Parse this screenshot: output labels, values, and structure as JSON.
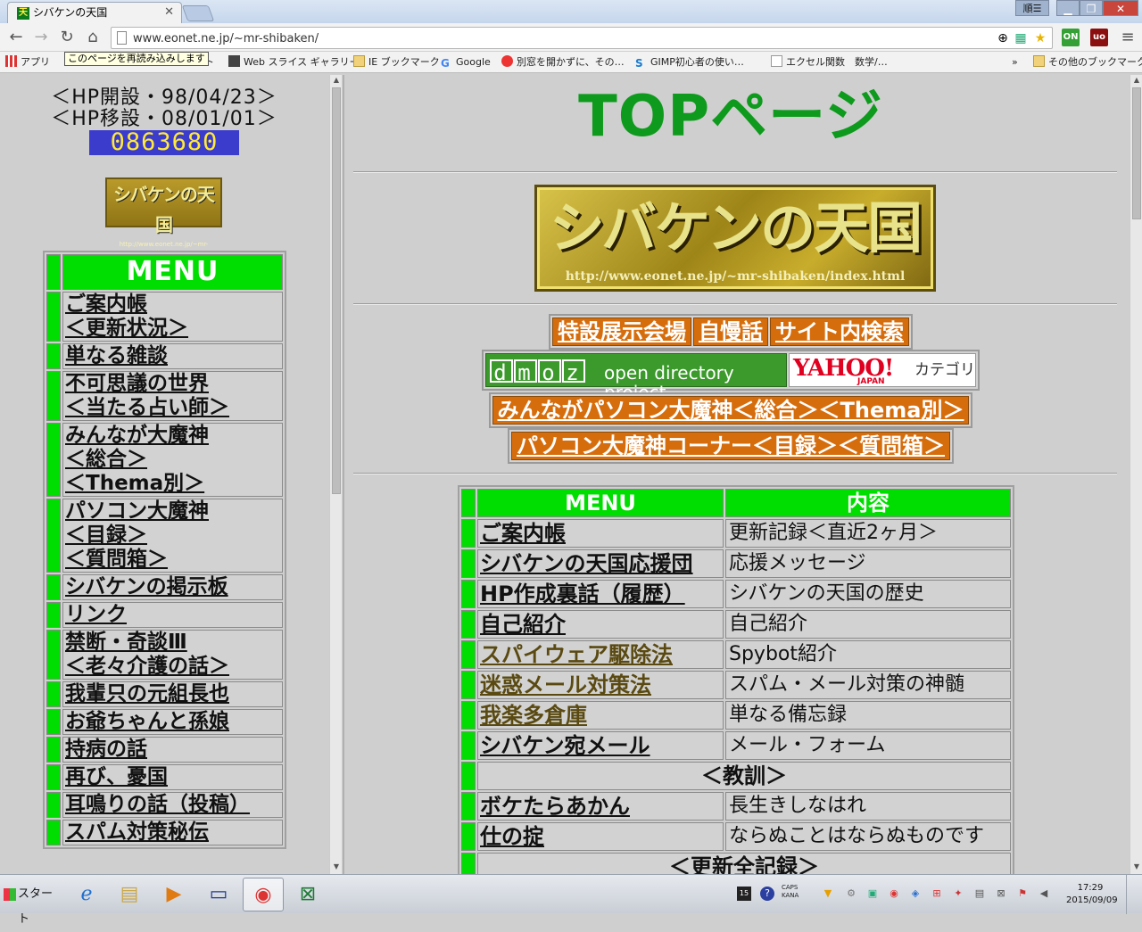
{
  "browser": {
    "tab_title": "シバケンの天国",
    "tab_favicon": "天",
    "window_user": "順",
    "url": "www.eonet.ne.jp/~mr-shibaken/",
    "tooltip": "このページを再読み込みします",
    "bookmarks": [
      {
        "label": "アプリ",
        "icon": "apps-grid-icon"
      },
      {
        "label": "イト",
        "icon": "page-icon"
      },
      {
        "label": "Web スライス ギャラリー",
        "icon": "web-slice-icon"
      },
      {
        "label": "IE ブックマーク",
        "icon": "folder-icon"
      },
      {
        "label": "Google",
        "icon": "google-icon"
      },
      {
        "label": "別窓を開かずに、その…",
        "icon": "red-ball-icon"
      },
      {
        "label": "GIMP初心者の使い…",
        "icon": "s-icon"
      },
      {
        "label": "エクセル関数　数学/…",
        "icon": "page-icon"
      }
    ],
    "bookmarks_overflow": "»",
    "other_bookmarks": "その他のブックマーク"
  },
  "sidebar": {
    "hp_open": "＜HP開設・98/04/23＞",
    "hp_move": "＜HP移設・08/01/01＞",
    "counter": "0863680",
    "small_logo_text": "シバケンの天国",
    "small_logo_url": "http://www.eonet.ne.jp/~mr-shibaken/",
    "menu_title": "MENU",
    "menu_items": [
      {
        "lines": [
          "ご案内帳",
          "＜更新状況＞"
        ]
      },
      {
        "lines": [
          "単なる雑談"
        ]
      },
      {
        "lines": [
          "不可思議の世界",
          "＜当たる占い師＞"
        ]
      },
      {
        "lines": [
          "みんなが大魔神",
          "＜総合＞",
          "＜Thema別＞"
        ]
      },
      {
        "lines": [
          "パソコン大魔神",
          "＜目録＞",
          "＜質問箱＞"
        ]
      },
      {
        "lines": [
          "シバケンの掲示板"
        ]
      },
      {
        "lines": [
          "リンク"
        ]
      },
      {
        "lines": [
          "禁断・奇談Ⅲ",
          "＜老々介護の話＞"
        ]
      },
      {
        "lines": [
          "我輩只の元組長也"
        ]
      },
      {
        "lines": [
          "お爺ちゃんと孫娘"
        ]
      },
      {
        "lines": [
          "持病の話"
        ]
      },
      {
        "lines": [
          "再び、憂国"
        ]
      },
      {
        "lines": [
          "耳鳴りの話（投稿）"
        ]
      },
      {
        "lines": [
          "スパム対策秘伝"
        ]
      }
    ]
  },
  "main": {
    "title": "TOPページ",
    "logo_text": "シバケンの天国",
    "logo_url": "http://www.eonet.ne.jp/~mr-shibaken/index.html",
    "buttons_row1": [
      "特設展示会場",
      "自慢話",
      "サイト内検索"
    ],
    "dmoz_letters": [
      "d",
      "m",
      "o",
      "z"
    ],
    "dmoz_text": "open directory project",
    "yahoo_logo": "YAHOO!",
    "yahoo_japan": "JAPAN",
    "yahoo_category": "カテゴリ",
    "button_row3": "みんながパソコン大魔神＜総合＞＜Thema別＞",
    "button_row4": "パソコン大魔神コーナー＜目録＞＜質問箱＞",
    "table": {
      "header": [
        "MENU",
        "内容"
      ],
      "rows": [
        {
          "link": "ご案内帳",
          "desc": "更新記録＜直近2ヶ月＞",
          "style": "dark"
        },
        {
          "link": "シバケンの天国応援団",
          "desc": "応援メッセージ",
          "style": "dark"
        },
        {
          "link": "HP作成裏話（履歴）",
          "desc": "シバケンの天国の歴史",
          "style": "dark"
        },
        {
          "link": "自己紹介",
          "desc": "自己紹介",
          "style": "dark"
        },
        {
          "link": "スパイウェア駆除法",
          "desc": "Spybot紹介",
          "style": "olive"
        },
        {
          "link": "迷惑メール対策法",
          "desc": "スパム・メール対策の神髄",
          "style": "olive"
        },
        {
          "link": "我楽多倉庫",
          "desc": "単なる備忘録",
          "style": "olive"
        },
        {
          "link": "シバケン宛メール",
          "desc": "メール・フォーム",
          "style": "dark"
        }
      ],
      "section_kyoukun": "＜教訓＞",
      "rows2": [
        {
          "link": "ボケたらあかん",
          "desc": "長生きしなはれ",
          "style": "dark"
        },
        {
          "link": "仕の掟",
          "desc": "ならぬことはならぬものです",
          "style": "dark"
        }
      ],
      "section_all": "＜更新全記録＞"
    }
  },
  "taskbar": {
    "start": "スタート",
    "tray_caps": "CAPS",
    "tray_kana": "KANA",
    "time": "17:29",
    "date": "2015/09/09"
  }
}
